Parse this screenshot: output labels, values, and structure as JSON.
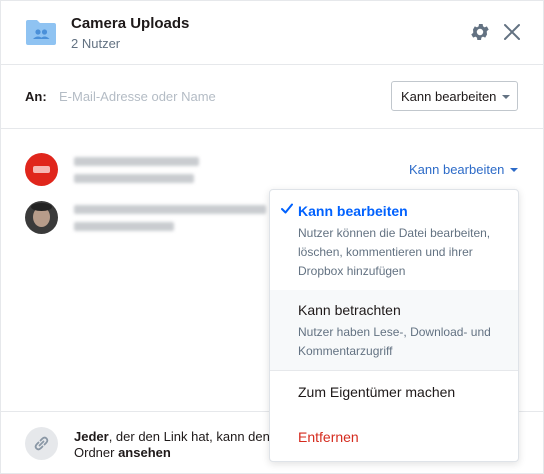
{
  "header": {
    "title": "Camera Uploads",
    "subtitle": "2 Nutzer",
    "folder_icon": "shared-folder-icon",
    "settings_icon": "gear-icon",
    "close_icon": "close-icon"
  },
  "invite": {
    "to_label": "An:",
    "email_placeholder": "E-Mail-Adresse oder Name",
    "email_value": "",
    "permission_label": "Kann bearbeiten"
  },
  "members": [
    {
      "avatar_color": "#e0261c",
      "permission_label": "Kann bearbeiten"
    },
    {
      "avatar_color": "#3a3a3a"
    }
  ],
  "permission_menu": {
    "items": [
      {
        "title": "Kann bearbeiten",
        "selected": true,
        "description": "Nutzer können die Datei bearbeiten, löschen, kommentieren und ihrer Dropbox hinzufügen"
      },
      {
        "title": "Kann betrachten",
        "selected": false,
        "description": "Nutzer haben Lese-, Download- und Kommentarzugriff"
      },
      {
        "title": "Zum Eigentümer machen"
      },
      {
        "title": "Entfernen"
      }
    ]
  },
  "footer": {
    "link_icon": "link-icon",
    "text_bold_1": "Jeder",
    "text_middle": ", der den Link hat, kann den Ordner ",
    "text_bold_2": "ansehen"
  },
  "colors": {
    "accent": "#0061fe",
    "link": "#2d6bc8",
    "danger": "#d52b1e",
    "folder": "#8fc3f2"
  }
}
